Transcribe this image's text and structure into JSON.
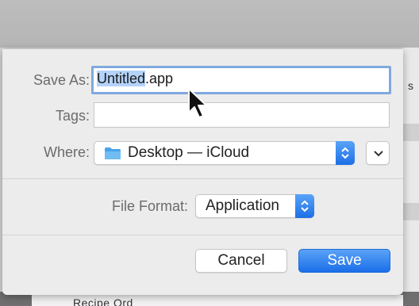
{
  "dialog": {
    "save_as": {
      "label": "Save As:",
      "selected_part": "Untitled",
      "extension": ".app"
    },
    "tags": {
      "label": "Tags:",
      "value": ""
    },
    "where": {
      "label": "Where:",
      "location": "Desktop — iCloud",
      "folder_icon": "folder-icon"
    },
    "file_format": {
      "label": "File Format:",
      "value": "Application"
    },
    "buttons": {
      "cancel": "Cancel",
      "save": "Save"
    },
    "colors": {
      "accent": "#1a6ee8",
      "focus_ring": "#7fa9df",
      "selection": "#b4d3fb"
    }
  },
  "background": {
    "bottom_text": "Recipe Ord",
    "side_glyph": "s"
  }
}
